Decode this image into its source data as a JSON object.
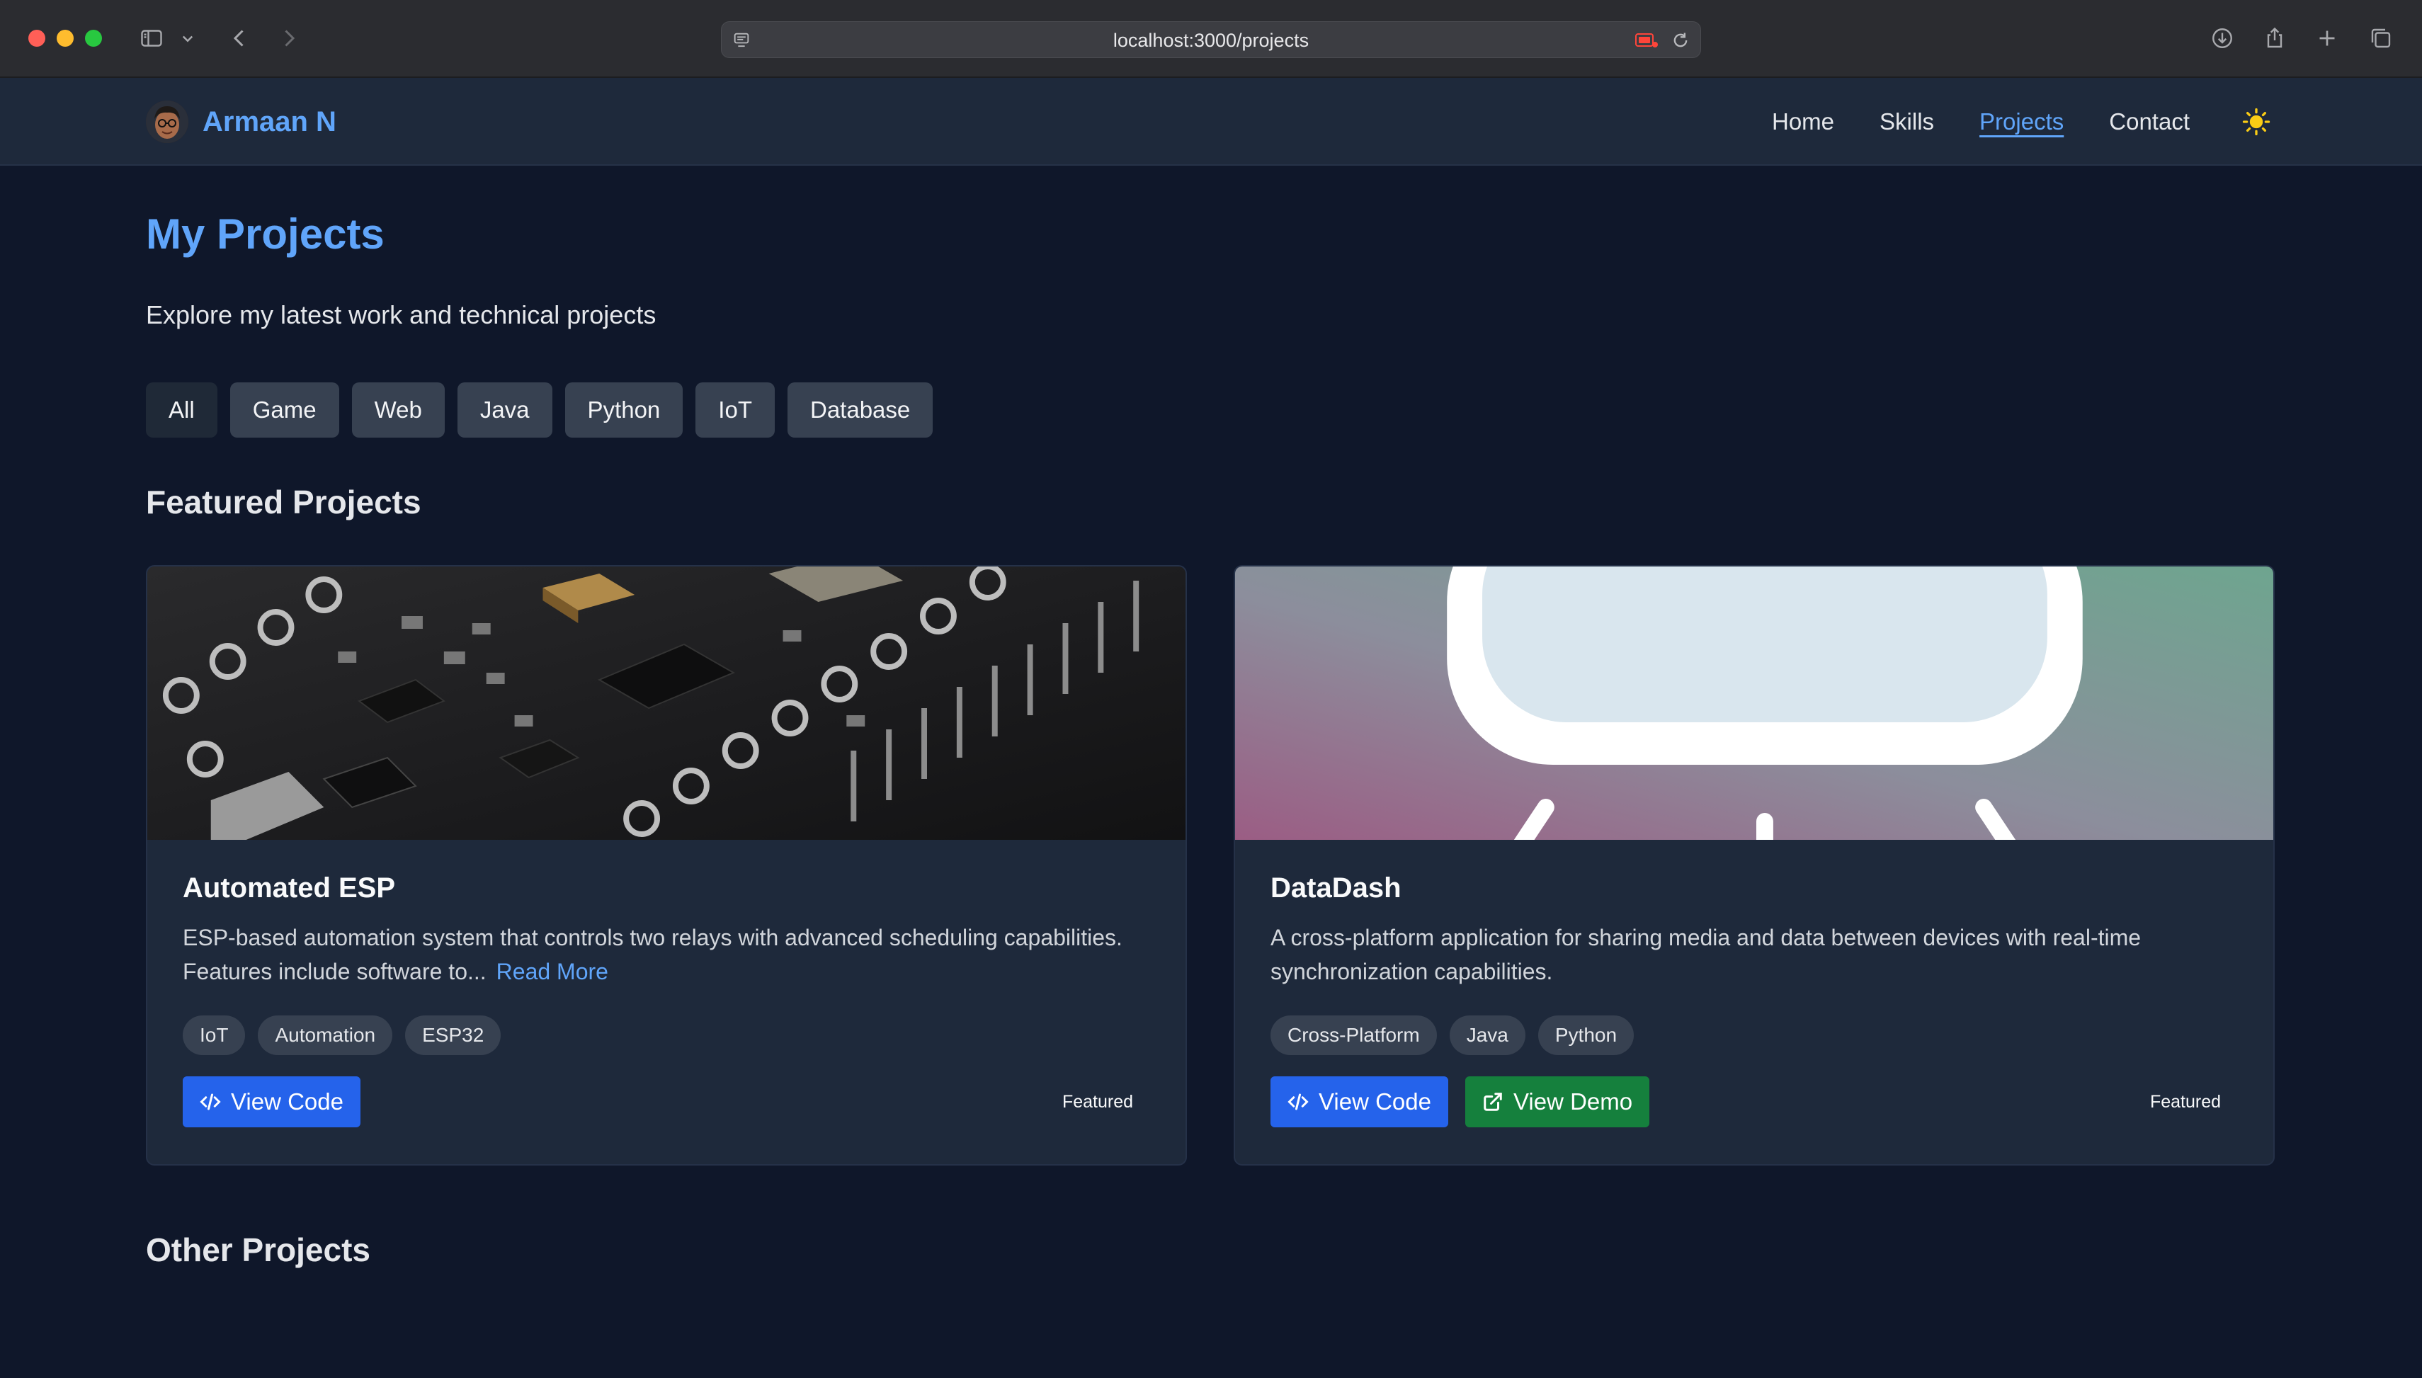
{
  "browser": {
    "url": "localhost:3000/projects"
  },
  "site": {
    "brand_name": "Armaan N",
    "nav": {
      "home": "Home",
      "skills": "Skills",
      "projects": "Projects",
      "contact": "Contact"
    }
  },
  "page": {
    "title": "My Projects",
    "subtitle": "Explore my latest work and technical projects",
    "filters": [
      "All",
      "Game",
      "Web",
      "Java",
      "Python",
      "IoT",
      "Database"
    ],
    "featured_heading": "Featured Projects",
    "other_heading": "Other Projects"
  },
  "projects": [
    {
      "title": "Automated ESP",
      "description": "ESP-based automation system that controls two relays with advanced scheduling capabilities. Features include software to...",
      "read_more": "Read More",
      "tags": [
        "IoT",
        "Automation",
        "ESP32"
      ],
      "view_code": "View Code",
      "featured": "Featured"
    },
    {
      "title": "DataDash",
      "description": "A cross-platform application for sharing media and data between devices with real-time synchronization capabilities.",
      "tags": [
        "Cross-Platform",
        "Java",
        "Python"
      ],
      "view_code": "View Code",
      "view_demo": "View Demo",
      "featured": "Featured"
    }
  ],
  "colors": {
    "accent": "#60a5fa",
    "background": "#0f172a",
    "card": "#1e293b",
    "code_button": "#2563eb",
    "demo_button": "#15803d",
    "sun": "#facc15"
  }
}
